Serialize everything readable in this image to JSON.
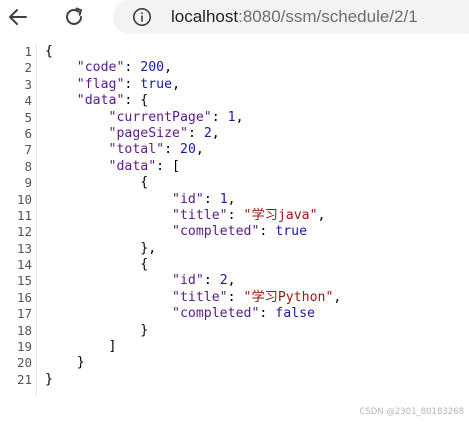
{
  "browser": {
    "url_host": "localhost",
    "url_path": ":8080/ssm/schedule/2/1",
    "icons": {
      "back": "back-arrow-icon",
      "reload": "reload-icon",
      "info": "info-icon"
    }
  },
  "code_lines": [
    {
      "no": "1",
      "indent": "",
      "parts": [
        {
          "t": "{",
          "c": "p"
        }
      ]
    },
    {
      "no": "2",
      "indent": "    ",
      "parts": [
        {
          "t": "\"code\"",
          "c": "k"
        },
        {
          "t": ": ",
          "c": "p"
        },
        {
          "t": "200",
          "c": "n"
        },
        {
          "t": ",",
          "c": "p"
        }
      ]
    },
    {
      "no": "3",
      "indent": "    ",
      "parts": [
        {
          "t": "\"flag\"",
          "c": "k"
        },
        {
          "t": ": ",
          "c": "p"
        },
        {
          "t": "true",
          "c": "b"
        },
        {
          "t": ",",
          "c": "p"
        }
      ]
    },
    {
      "no": "4",
      "indent": "    ",
      "parts": [
        {
          "t": "\"data\"",
          "c": "k"
        },
        {
          "t": ": {",
          "c": "p"
        }
      ]
    },
    {
      "no": "5",
      "indent": "        ",
      "parts": [
        {
          "t": "\"currentPage\"",
          "c": "k"
        },
        {
          "t": ": ",
          "c": "p"
        },
        {
          "t": "1",
          "c": "n"
        },
        {
          "t": ",",
          "c": "p"
        }
      ]
    },
    {
      "no": "6",
      "indent": "        ",
      "parts": [
        {
          "t": "\"pageSize\"",
          "c": "k"
        },
        {
          "t": ": ",
          "c": "p"
        },
        {
          "t": "2",
          "c": "n"
        },
        {
          "t": ",",
          "c": "p"
        }
      ]
    },
    {
      "no": "7",
      "indent": "        ",
      "parts": [
        {
          "t": "\"total\"",
          "c": "k"
        },
        {
          "t": ": ",
          "c": "p"
        },
        {
          "t": "20",
          "c": "n"
        },
        {
          "t": ",",
          "c": "p"
        }
      ]
    },
    {
      "no": "8",
      "indent": "        ",
      "parts": [
        {
          "t": "\"data\"",
          "c": "k"
        },
        {
          "t": ": [",
          "c": "p"
        }
      ]
    },
    {
      "no": "9",
      "indent": "            ",
      "parts": [
        {
          "t": "{",
          "c": "p"
        }
      ]
    },
    {
      "no": "10",
      "indent": "                ",
      "parts": [
        {
          "t": "\"id\"",
          "c": "k"
        },
        {
          "t": ": ",
          "c": "p"
        },
        {
          "t": "1",
          "c": "n"
        },
        {
          "t": ",",
          "c": "p"
        }
      ]
    },
    {
      "no": "11",
      "indent": "                ",
      "parts": [
        {
          "t": "\"title\"",
          "c": "k"
        },
        {
          "t": ": ",
          "c": "p"
        },
        {
          "t": "\"学习java\"",
          "c": "s"
        },
        {
          "t": ",",
          "c": "p"
        }
      ]
    },
    {
      "no": "12",
      "indent": "                ",
      "parts": [
        {
          "t": "\"completed\"",
          "c": "k"
        },
        {
          "t": ": ",
          "c": "p"
        },
        {
          "t": "true",
          "c": "b"
        }
      ]
    },
    {
      "no": "13",
      "indent": "            ",
      "parts": [
        {
          "t": "},",
          "c": "p"
        }
      ]
    },
    {
      "no": "14",
      "indent": "            ",
      "parts": [
        {
          "t": "{",
          "c": "p"
        }
      ]
    },
    {
      "no": "15",
      "indent": "                ",
      "parts": [
        {
          "t": "\"id\"",
          "c": "k"
        },
        {
          "t": ": ",
          "c": "p"
        },
        {
          "t": "2",
          "c": "n"
        },
        {
          "t": ",",
          "c": "p"
        }
      ]
    },
    {
      "no": "16",
      "indent": "                ",
      "parts": [
        {
          "t": "\"title\"",
          "c": "k"
        },
        {
          "t": ": ",
          "c": "p"
        },
        {
          "t": "\"学习Python\"",
          "c": "s"
        },
        {
          "t": ",",
          "c": "p"
        }
      ]
    },
    {
      "no": "17",
      "indent": "                ",
      "parts": [
        {
          "t": "\"completed\"",
          "c": "k"
        },
        {
          "t": ": ",
          "c": "p"
        },
        {
          "t": "false",
          "c": "b"
        }
      ]
    },
    {
      "no": "18",
      "indent": "            ",
      "parts": [
        {
          "t": "}",
          "c": "p"
        }
      ]
    },
    {
      "no": "19",
      "indent": "        ",
      "parts": [
        {
          "t": "]",
          "c": "p"
        }
      ]
    },
    {
      "no": "20",
      "indent": "    ",
      "parts": [
        {
          "t": "}",
          "c": "p"
        }
      ]
    },
    {
      "no": "21",
      "indent": "",
      "parts": [
        {
          "t": "}",
          "c": "p"
        }
      ]
    }
  ],
  "watermark": "CSDN @2301_80183268",
  "colors": {
    "key": "#5a1a8a",
    "number": "#1a1aa6",
    "string": "#a31515",
    "boolean": "#1a1aa6",
    "address_bar_bg": "#f1f3f4"
  }
}
